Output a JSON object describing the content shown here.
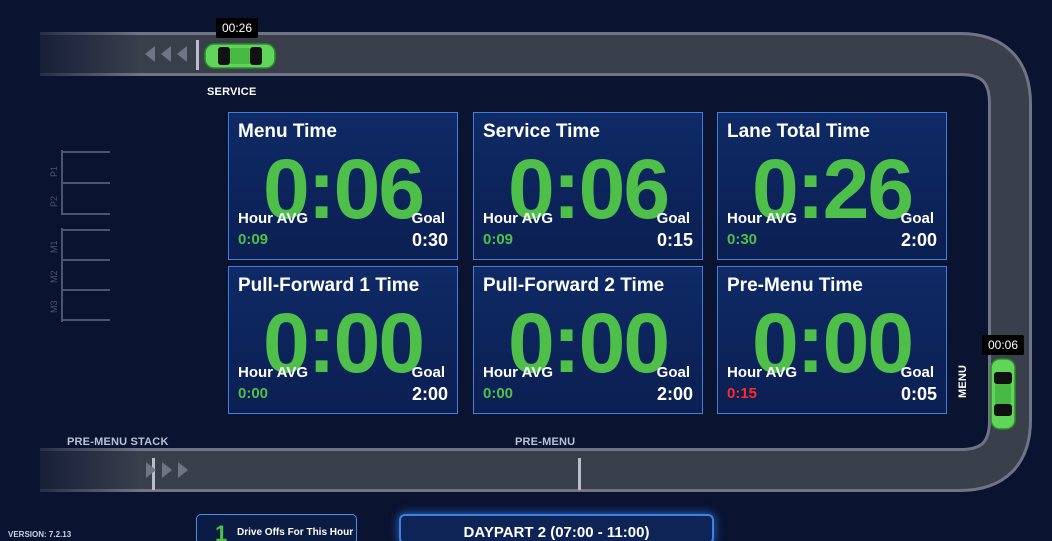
{
  "lane": {
    "service_car_timer": "00:26",
    "menu_car_timer": "00:06",
    "labels": {
      "service": "SERVICE",
      "menu": "MENU",
      "pre_menu": "PRE-MENU",
      "pre_menu_stack": "PRE-MENU STACK"
    },
    "bays": [
      "P1",
      "P2",
      "M1",
      "M2",
      "M3"
    ]
  },
  "panels": [
    {
      "title": "Menu Time",
      "value": "0:06",
      "hour_avg_label": "Hour AVG",
      "hour_avg": "0:09",
      "goal_label": "Goal",
      "goal": "0:30",
      "hour_avg_status": "ok"
    },
    {
      "title": "Service Time",
      "value": "0:06",
      "hour_avg_label": "Hour AVG",
      "hour_avg": "0:09",
      "goal_label": "Goal",
      "goal": "0:15",
      "hour_avg_status": "ok"
    },
    {
      "title": "Lane Total Time",
      "value": "0:26",
      "hour_avg_label": "Hour AVG",
      "hour_avg": "0:30",
      "goal_label": "Goal",
      "goal": "2:00",
      "hour_avg_status": "ok"
    },
    {
      "title": "Pull-Forward 1 Time",
      "value": "0:00",
      "hour_avg_label": "Hour AVG",
      "hour_avg": "0:00",
      "goal_label": "Goal",
      "goal": "2:00",
      "hour_avg_status": "ok"
    },
    {
      "title": "Pull-Forward 2 Time",
      "value": "0:00",
      "hour_avg_label": "Hour AVG",
      "hour_avg": "0:00",
      "goal_label": "Goal",
      "goal": "2:00",
      "hour_avg_status": "ok"
    },
    {
      "title": "Pre-Menu Time",
      "value": "0:00",
      "hour_avg_label": "Hour AVG",
      "hour_avg": "0:15",
      "goal_label": "Goal",
      "goal": "0:05",
      "hour_avg_status": "over"
    }
  ],
  "footer": {
    "drive_offs_count": "1",
    "drive_offs_label": "Drive Offs For This Hour",
    "daypart": "DAYPART 2 (07:00 - 11:00)",
    "version": "VERSION: 7.2.13"
  },
  "colors": {
    "background": "#0a1330",
    "road": "#3a3f4c",
    "timer_green": "#4ec04a",
    "alert_red": "#ff2a2a",
    "panel_border": "#3f7fe0",
    "car_green": "#5fd65a"
  },
  "icons": {
    "direction_left": "triangle-left-icon",
    "direction_right": "triangle-right-icon",
    "car": "car-icon"
  }
}
